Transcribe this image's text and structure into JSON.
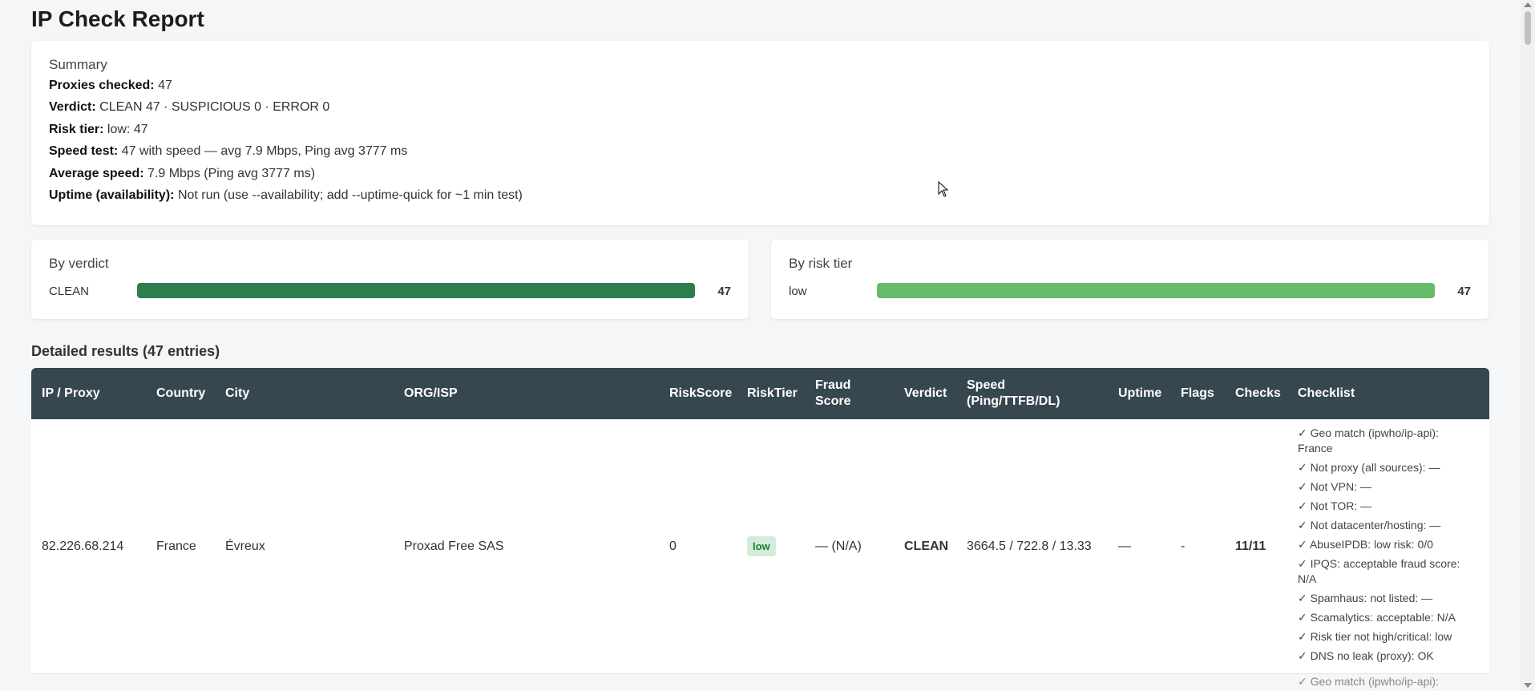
{
  "page_title": "IP Check Report",
  "summary": {
    "title": "Summary",
    "proxies_label": "Proxies checked:",
    "proxies_value": "47",
    "verdict_label": "Verdict:",
    "verdict_value": "CLEAN 47 · SUSPICIOUS 0 · ERROR 0",
    "risk_label": "Risk tier:",
    "risk_value": "low: 47",
    "speed_label": "Speed test:",
    "speed_value": "47 with speed — avg 7.9 Mbps, Ping avg 3777 ms",
    "avg_speed_label": "Average speed:",
    "avg_speed_value": "7.9 Mbps (Ping avg 3777 ms)",
    "uptime_label": "Uptime (availability):",
    "uptime_value": "Not run (use --availability; add --uptime-quick for ~1 min test)"
  },
  "by_verdict": {
    "title": "By verdict",
    "label": "CLEAN",
    "count": "47",
    "fraction": 1.0,
    "color": "#2e7d4f"
  },
  "by_risk_tier": {
    "title": "By risk tier",
    "label": "low",
    "count": "47",
    "fraction": 1.0,
    "color": "#66bb6a"
  },
  "detailed_title": "Detailed results (47 entries)",
  "table": {
    "headers": {
      "ip": "IP / Proxy",
      "country": "Country",
      "city": "City",
      "org": "ORG/ISP",
      "riskscore": "RiskScore",
      "risktier": "RiskTier",
      "fraud": "Fraud Score",
      "verdict": "Verdict",
      "speed": "Speed (Ping/TTFB/DL)",
      "uptime": "Uptime",
      "flags": "Flags",
      "checks": "Checks",
      "checklist": "Checklist"
    },
    "rows": [
      {
        "ip": "82.226.68.214",
        "country": "France",
        "city": "Évreux",
        "org": "Proxad Free SAS",
        "riskscore": "0",
        "risktier": "low",
        "fraud": "— (N/A)",
        "verdict": "CLEAN",
        "speed": "3664.5 / 722.8 / 13.33",
        "uptime": "—",
        "flags": "-",
        "checks": "11/11",
        "checklist": [
          "✓ Geo match (ipwho/ip-api): France",
          "✓ Not proxy (all sources): —",
          "✓ Not VPN: —",
          "✓ Not TOR: —",
          "✓ Not datacenter/hosting: —",
          "✓ AbuseIPDB: low risk: 0/0",
          "✓ IPQS: acceptable fraud score: N/A",
          "✓ Spamhaus: not listed: —",
          "✓ Scamalytics: acceptable: N/A",
          "✓ Risk tier not high/critical: low",
          "✓ DNS no leak (proxy): OK"
        ]
      }
    ],
    "next_row_partial": "✓ Geo match (ipwho/ip-api):"
  }
}
